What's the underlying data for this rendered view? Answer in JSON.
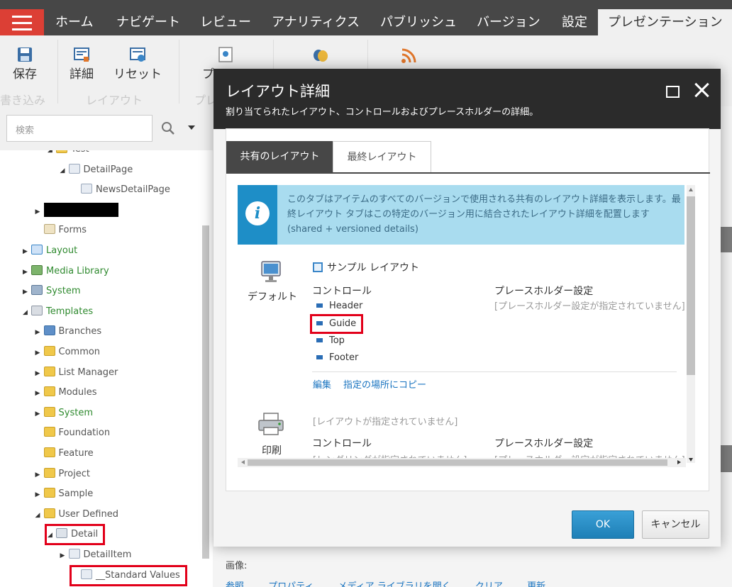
{
  "topbar": {
    "tabs": [
      "ホーム",
      "ナビゲート",
      "レビュー",
      "アナリティクス",
      "パブリッシュ",
      "バージョン",
      "設定",
      "プレゼンテーション"
    ]
  },
  "ribbon": {
    "save_label": "保存",
    "detail_label": "詳細",
    "reset_label": "リセット",
    "preview_partial": "プレ",
    "group_write": "書き込み",
    "group_layout": "レイアウト",
    "group_partial": "プレ"
  },
  "search": {
    "placeholder": "検索"
  },
  "tree": [
    {
      "label": "Test",
      "indent": 4,
      "arrow": "expanded",
      "icon": "folder",
      "style": "normal"
    },
    {
      "label": "DetailPage",
      "indent": 5,
      "arrow": "expanded",
      "icon": "page",
      "style": "normal"
    },
    {
      "label": "NewsDetailPage",
      "indent": 6,
      "arrow": "none",
      "icon": "page",
      "style": "normal"
    },
    {
      "label": "",
      "indent": 3,
      "arrow": "collapsed",
      "icon": "redacted",
      "style": "redacted"
    },
    {
      "label": "Forms",
      "indent": 3,
      "arrow": "none",
      "icon": "forms",
      "style": "normal"
    },
    {
      "label": "Layout",
      "indent": 2,
      "arrow": "collapsed",
      "icon": "layout",
      "style": "green"
    },
    {
      "label": "Media Library",
      "indent": 2,
      "arrow": "collapsed",
      "icon": "media",
      "style": "green"
    },
    {
      "label": "System",
      "indent": 2,
      "arrow": "collapsed",
      "icon": "system",
      "style": "green"
    },
    {
      "label": "Templates",
      "indent": 2,
      "arrow": "expanded",
      "icon": "templates",
      "style": "green"
    },
    {
      "label": "Branches",
      "indent": 3,
      "arrow": "collapsed",
      "icon": "branches",
      "style": "normal"
    },
    {
      "label": "Common",
      "indent": 3,
      "arrow": "collapsed",
      "icon": "folder",
      "style": "normal"
    },
    {
      "label": "List Manager",
      "indent": 3,
      "arrow": "collapsed",
      "icon": "folder",
      "style": "normal"
    },
    {
      "label": "Modules",
      "indent": 3,
      "arrow": "collapsed",
      "icon": "folder",
      "style": "normal"
    },
    {
      "label": "System",
      "indent": 3,
      "arrow": "collapsed",
      "icon": "folder",
      "style": "green"
    },
    {
      "label": "Foundation",
      "indent": 3,
      "arrow": "none",
      "icon": "folder",
      "style": "normal"
    },
    {
      "label": "Feature",
      "indent": 3,
      "arrow": "none",
      "icon": "folder",
      "style": "normal"
    },
    {
      "label": "Project",
      "indent": 3,
      "arrow": "collapsed",
      "icon": "folder",
      "style": "normal"
    },
    {
      "label": "Sample",
      "indent": 3,
      "arrow": "collapsed",
      "icon": "folder",
      "style": "normal"
    },
    {
      "label": "User Defined",
      "indent": 3,
      "arrow": "expanded",
      "icon": "folder",
      "style": "normal"
    },
    {
      "label": "Detail",
      "indent": 4,
      "arrow": "expanded",
      "icon": "template",
      "style": "highlight"
    },
    {
      "label": "DetailItem",
      "indent": 5,
      "arrow": "collapsed",
      "icon": "page",
      "style": "normal"
    },
    {
      "label": "__Standard Values",
      "indent": 6,
      "arrow": "none",
      "icon": "page",
      "style": "highlight"
    }
  ],
  "bottom": {
    "image_label": "画像:",
    "links": [
      "参照",
      "プロパティ",
      "メディア ライブラリを開く",
      "クリア",
      "更新"
    ]
  },
  "modal": {
    "title": "レイアウト詳細",
    "subtitle": "割り当てられたレイアウト、コントロールおよびプレースホルダーの詳細。",
    "tabs": {
      "shared": "共有のレイアウト",
      "final": "最終レイアウト"
    },
    "info": "このタブはアイテムのすべてのバージョンで使用される共有のレイアウト詳細を表示します。最終レイアウト タブはこの特定のバージョン用に結合されたレイアウト詳細を配置します (shared + versioned details)",
    "default_device": {
      "name": "デフォルト",
      "layout": "サンプル レイアウト",
      "controls_head": "コントロール",
      "placeholder_head": "プレースホルダー設定",
      "placeholder_none": "[プレースホルダー設定が指定されていません]",
      "controls": [
        "Header",
        "Guide",
        "Top",
        "Footer"
      ],
      "edit": "編集",
      "copy": "指定の場所にコピー"
    },
    "print_device": {
      "name": "印刷",
      "layout_none": "[レイアウトが指定されていません]",
      "controls_head": "コントロール",
      "controls_none": "[レンダリングが指定されていません]",
      "placeholder_head": "プレースホルダー設定",
      "placeholder_none": "[プレースホルダー設定が指定されていません]"
    },
    "ok": "OK",
    "cancel": "キャンセル"
  },
  "colors": {
    "accent_red": "#dc3f35",
    "topbar": "#474747",
    "info_blue": "#1e8ec7",
    "ok_blue": "#1e7fb6",
    "highlight_red": "#e2001a"
  }
}
